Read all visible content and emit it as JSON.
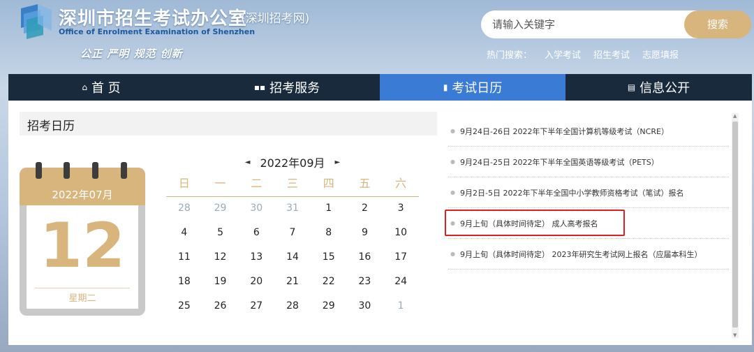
{
  "header": {
    "title": "深圳市招生考试办公室",
    "subtitle": "(深圳招考网)",
    "english": "Office of Enrolment Examination of Shenzhen",
    "slogan": "公正  严明  规范  创新",
    "logo_icon": "logo-icon"
  },
  "search": {
    "placeholder": "请输入关键字",
    "button": "搜索",
    "hot_label": "热门搜索：",
    "hot_items": [
      "入学考试",
      "招生考试",
      "志愿填报"
    ]
  },
  "nav": {
    "items": [
      {
        "label": "首 页",
        "icon": "home-icon",
        "glyph": "⌂"
      },
      {
        "label": "招考服务",
        "icon": "grid-icon",
        "glyph": "▪▪"
      },
      {
        "label": "考试日历",
        "icon": "calendar-icon",
        "glyph": "▮",
        "active": true
      },
      {
        "label": "信息公开",
        "icon": "doc-icon",
        "glyph": "▤"
      }
    ],
    "accent": "#3a7bd5",
    "bg": "#1a2a3d"
  },
  "panel": {
    "title": "招考日历"
  },
  "tear_calendar": {
    "month": "2022年07月",
    "day": "12",
    "weekday": "星期二",
    "color": "#d8b57c"
  },
  "month_calendar": {
    "title": "2022年09月",
    "prev": "◄",
    "next": "►",
    "weekdays": [
      "日",
      "一",
      "二",
      "三",
      "四",
      "五",
      "六"
    ],
    "days": [
      "28",
      "29",
      "30",
      "31",
      "1",
      "2",
      "3",
      "4",
      "5",
      "6",
      "7",
      "8",
      "9",
      "10",
      "11",
      "12",
      "13",
      "14",
      "15",
      "16",
      "17",
      "18",
      "19",
      "20",
      "21",
      "22",
      "23",
      "24",
      "25",
      "26",
      "27",
      "28",
      "29",
      "30",
      "1"
    ],
    "other_month": [
      0,
      1,
      2,
      3,
      34
    ]
  },
  "events": [
    {
      "text": "9月24日-26日  2022年下半年全国计算机等级考试（NCRE）"
    },
    {
      "text": "9月24日-25日  2022年下半年全国英语等级考试（PETS）"
    },
    {
      "text": "9月2日-5日  2022年下半年全国中小学教师资格考试（笔试）报名"
    },
    {
      "text": "9月上旬（具体时间待定） 成人高考报名",
      "highlighted": true
    },
    {
      "text": "9月上旬（具体时间待定） 2023年研究生考试网上报名（应届本科生）"
    }
  ]
}
